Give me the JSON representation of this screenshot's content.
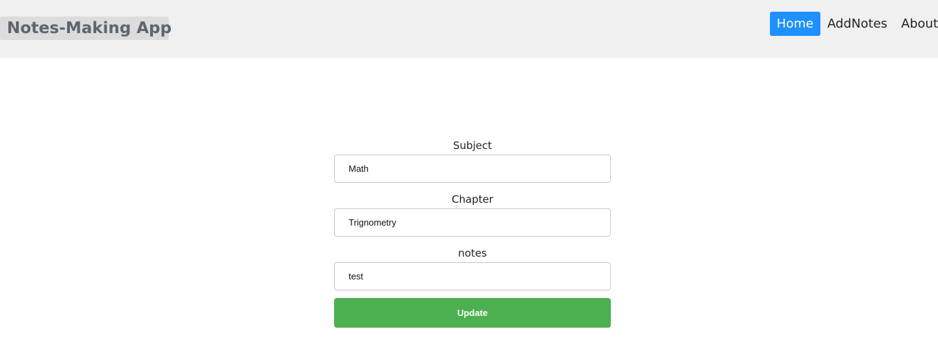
{
  "navbar": {
    "brand": "Notes-Making App",
    "links": [
      {
        "label": "Home",
        "active": true
      },
      {
        "label": "AddNotes",
        "active": false
      },
      {
        "label": "About",
        "active": false
      }
    ]
  },
  "form": {
    "subject_label": "Subject",
    "subject_value": "Math",
    "chapter_label": "Chapter",
    "chapter_value": "Trignometry",
    "notes_label": "notes",
    "notes_value": "test",
    "submit_label": "Update"
  },
  "colors": {
    "navbar_bg": "#f0f0f0",
    "active_link": "#1e90ff",
    "update_button": "#4caf50"
  }
}
